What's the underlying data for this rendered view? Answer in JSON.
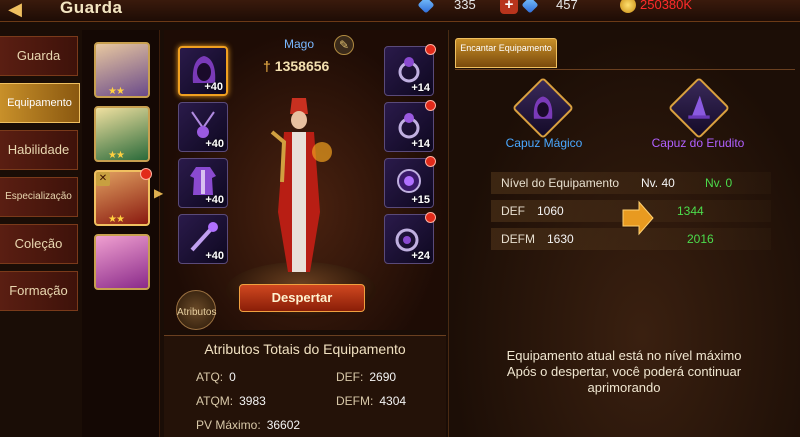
{
  "header": {
    "title": "Guarda",
    "gems": "335",
    "locked_gems": "457",
    "gold": "250380K"
  },
  "menu": {
    "items": [
      "Guarda",
      "Equipamento",
      "Habilidade",
      "Especialização",
      "Coleção",
      "Formação"
    ]
  },
  "heroes": [
    {
      "stars": "★★"
    },
    {
      "stars": "★★"
    },
    {
      "stars": "★★"
    },
    {
      "stars": ""
    }
  ],
  "equipment": {
    "class_label": "Mago",
    "power": "1358656",
    "left_slots": [
      "+40",
      "+40",
      "+40",
      "+40"
    ],
    "right_slots": [
      "+14",
      "+14",
      "+15",
      "+24"
    ],
    "awaken_label": "Despertar",
    "attributes_label": "Atributos"
  },
  "totals": {
    "title": "Atributos Totais do Equipamento",
    "atq_label": "ATQ:",
    "atq": "0",
    "def_label": "DEF:",
    "def": "2690",
    "atqm_label": "ATQM:",
    "atqm": "3983",
    "defm_label": "DEFM:",
    "defm": "4304",
    "pv_label": "PV Máximo:",
    "pv": "36602"
  },
  "enchant": {
    "tab_label": "Encantar Equipamento",
    "current_item": "Capuz Mágico",
    "next_item": "Capuz do Erudito",
    "level_label": "Nível do Equipamento",
    "level_cur": "Nv. 40",
    "level_next": "Nv. 0",
    "def_label": "DEF",
    "def_cur": "1060",
    "def_next": "1344",
    "defm_label": "DEFM",
    "defm_cur": "1630",
    "defm_next": "2016",
    "max_msg_1": "Equipamento atual está no nível máximo",
    "max_msg_2": "Após o despertar, você poderá continuar",
    "max_msg_3": "aprimorando"
  },
  "colors": {
    "current_item": "#4aa8ff",
    "next_item": "#b060ff",
    "upgrade": "#4cdc4c",
    "gold": "#ff2a2a"
  }
}
